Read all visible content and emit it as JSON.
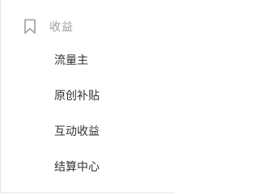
{
  "sidebar": {
    "section": {
      "icon": "bookmark-icon",
      "title": "收益"
    },
    "items": [
      {
        "label": "流量主"
      },
      {
        "label": "原创补贴"
      },
      {
        "label": "互动收益"
      },
      {
        "label": "结算中心"
      }
    ]
  },
  "colors": {
    "section_title": "#9e9e9e",
    "icon_stroke": "#a8a8a8",
    "item_text": "#333333",
    "border": "#e6e6e6"
  }
}
